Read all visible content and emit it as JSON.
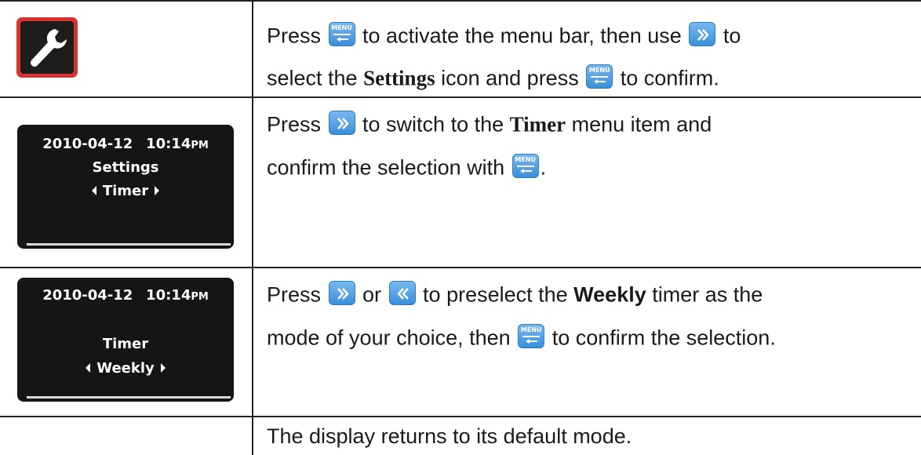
{
  "rows": [
    {
      "icon": "wrench-icon",
      "lines": [
        {
          "t1": "Press ",
          "b1": "menu-enter-button",
          "t2": " to activate the menu bar, then use ",
          "b2": "right-arrow-button",
          "t3": " to"
        },
        {
          "t1": "select the ",
          "kw": "Settings",
          "t2": " icon and press ",
          "b1": "menu-enter-button",
          "t3": " to confirm."
        }
      ]
    },
    {
      "display": {
        "date": "2010-04-12",
        "time": "10:14",
        "ampm": "PM",
        "line2": "Settings",
        "line3": "Timer"
      },
      "lines": [
        {
          "t1": "Press ",
          "b1": "right-arrow-button",
          "t2": " to switch to the ",
          "kw": "Timer",
          "t3": " menu item and"
        },
        {
          "t1": "confirm the selection with ",
          "b1": "menu-enter-button",
          "t2": "."
        }
      ]
    },
    {
      "display": {
        "date": "2010-04-12",
        "time": "10:14",
        "ampm": "PM",
        "line2": "Timer",
        "line3": "Weekly"
      },
      "lines": [
        {
          "t1": "Press ",
          "b1": "right-arrow-button",
          "t2": " or ",
          "b2": "left-arrow-button",
          "t3": " to preselect the ",
          "kw": "Weekly",
          "t4": " timer as the"
        },
        {
          "t1": "mode of your choice, then ",
          "b1": "menu-enter-button",
          "t2": " to confirm the selection."
        }
      ]
    },
    {
      "lines": [
        {
          "t1": "The display returns to its default mode."
        }
      ]
    }
  ],
  "button_label": "MENU",
  "colors": {
    "button": "#3a8fd9",
    "wrench_frame": "#d8332f",
    "lcd_bg": "#151515"
  }
}
